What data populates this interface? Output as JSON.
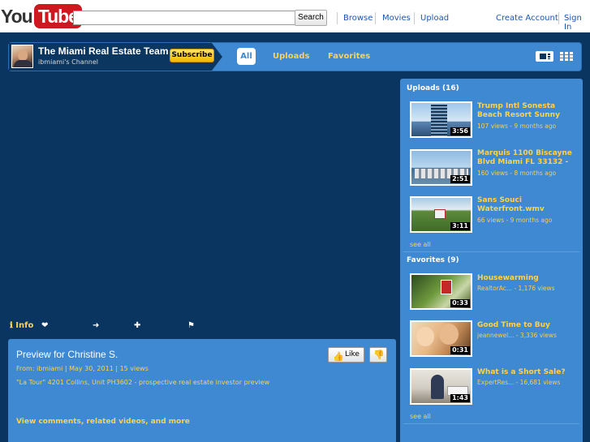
{
  "masthead": {
    "logo_you": "You",
    "logo_tube": "Tube",
    "search_value": "",
    "search_button": "Search",
    "nav": [
      "Browse",
      "Movies",
      "Upload"
    ],
    "account": [
      "Create Account",
      "Sign In"
    ]
  },
  "channel": {
    "name": "The Miami Real Estate Team",
    "subtitle": "ibmiami's Channel",
    "subscribe_label": "Subscribe",
    "tabs": [
      "All",
      "Uploads",
      "Favorites"
    ]
  },
  "actions": {
    "info_label": "Info",
    "icons": [
      "info-icon",
      "heart-icon",
      "share-icon",
      "add-icon",
      "flag-icon"
    ]
  },
  "video": {
    "title": "Preview for Christine S.",
    "meta": "From: ibmiami | May 30, 2011 | 15 views",
    "description": "\"La Tour\" 4201 Collins, Unit PH3602 - prospective real estate investor preview",
    "more_link": "View comments, related videos, and more",
    "like_label": "Like"
  },
  "sidebar": {
    "uploads_title": "Uploads (16)",
    "uploads": [
      {
        "title": "Trump Intl Sonesta Beach Resort Sunny",
        "meta": "107 views - 9 months ago",
        "duration": "3:56"
      },
      {
        "title": "Marquis 1100 Biscayne Blvd Miami FL 33132 -",
        "meta": "160 views - 8 months ago",
        "duration": "2:51"
      },
      {
        "title": "Sans Souci Waterfront.wmv",
        "meta": "66 views - 9 months ago",
        "duration": "3:11"
      }
    ],
    "uploads_see_all": "see all",
    "favorites_title": "Favorites (9)",
    "favorites": [
      {
        "title": "Housewarming",
        "meta": "RealtorAc... - 1,176 views",
        "duration": "0:33"
      },
      {
        "title": "Good Time to Buy",
        "meta": "jeannewel... - 3,336 views",
        "duration": "0:31"
      },
      {
        "title": "What is a Short Sale?",
        "meta": "ExpertRes... - 16,681 views",
        "duration": "1:43"
      }
    ],
    "favorites_see_all": "see all"
  },
  "colors": {
    "panel_blue": "#3e89d2",
    "dark_navy": "#0a3561",
    "link_yellow": "#ffd24d",
    "logo_red": "#cc181e"
  }
}
